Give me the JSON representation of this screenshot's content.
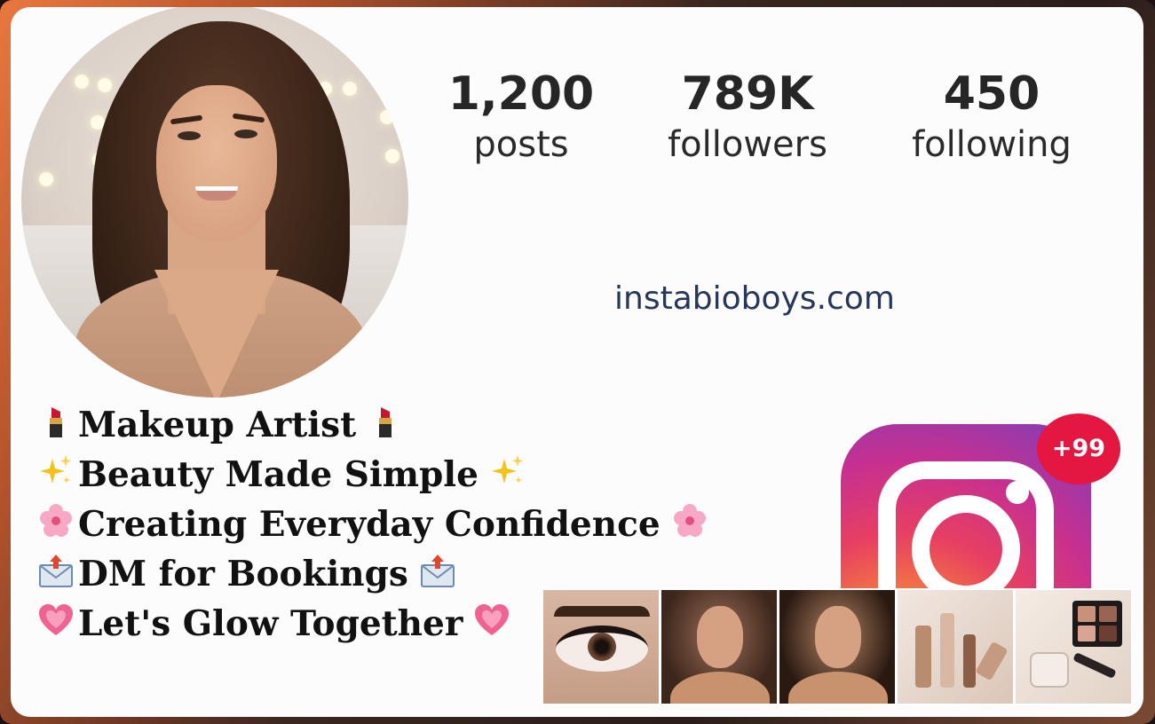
{
  "profile": {
    "avatar_alt": "profile-photo",
    "stats": [
      {
        "value": "1,200",
        "label": "posts"
      },
      {
        "value": "789K",
        "label": "followers"
      },
      {
        "value": "450",
        "label": "following"
      }
    ],
    "link": "instabioboys.com"
  },
  "bio": {
    "lines": [
      {
        "emoji": "lipstick-icon",
        "text": "Makeup Artist"
      },
      {
        "emoji": "sparkles-icon",
        "text": "Beauty Made Simple"
      },
      {
        "emoji": "cherry-blossom-icon",
        "text": "Creating Everyday Confidence"
      },
      {
        "emoji": "envelope-outgoing-icon",
        "text": "DM for Bookings"
      },
      {
        "emoji": "growing-heart-icon",
        "text": "Let's Glow Together"
      }
    ]
  },
  "instagram": {
    "icon": "instagram-logo-icon",
    "notification_badge": "+99"
  },
  "posts": [
    {
      "name": "eye-makeup-closeup"
    },
    {
      "name": "glam-portrait-1"
    },
    {
      "name": "glam-portrait-2"
    },
    {
      "name": "makeup-products-flatlay"
    },
    {
      "name": "eyeshadow-palette-flatlay"
    }
  ],
  "colors": {
    "frame_accent": "#e9773f",
    "link": "#27375a",
    "badge": "#e3173f",
    "text": "#262626"
  }
}
